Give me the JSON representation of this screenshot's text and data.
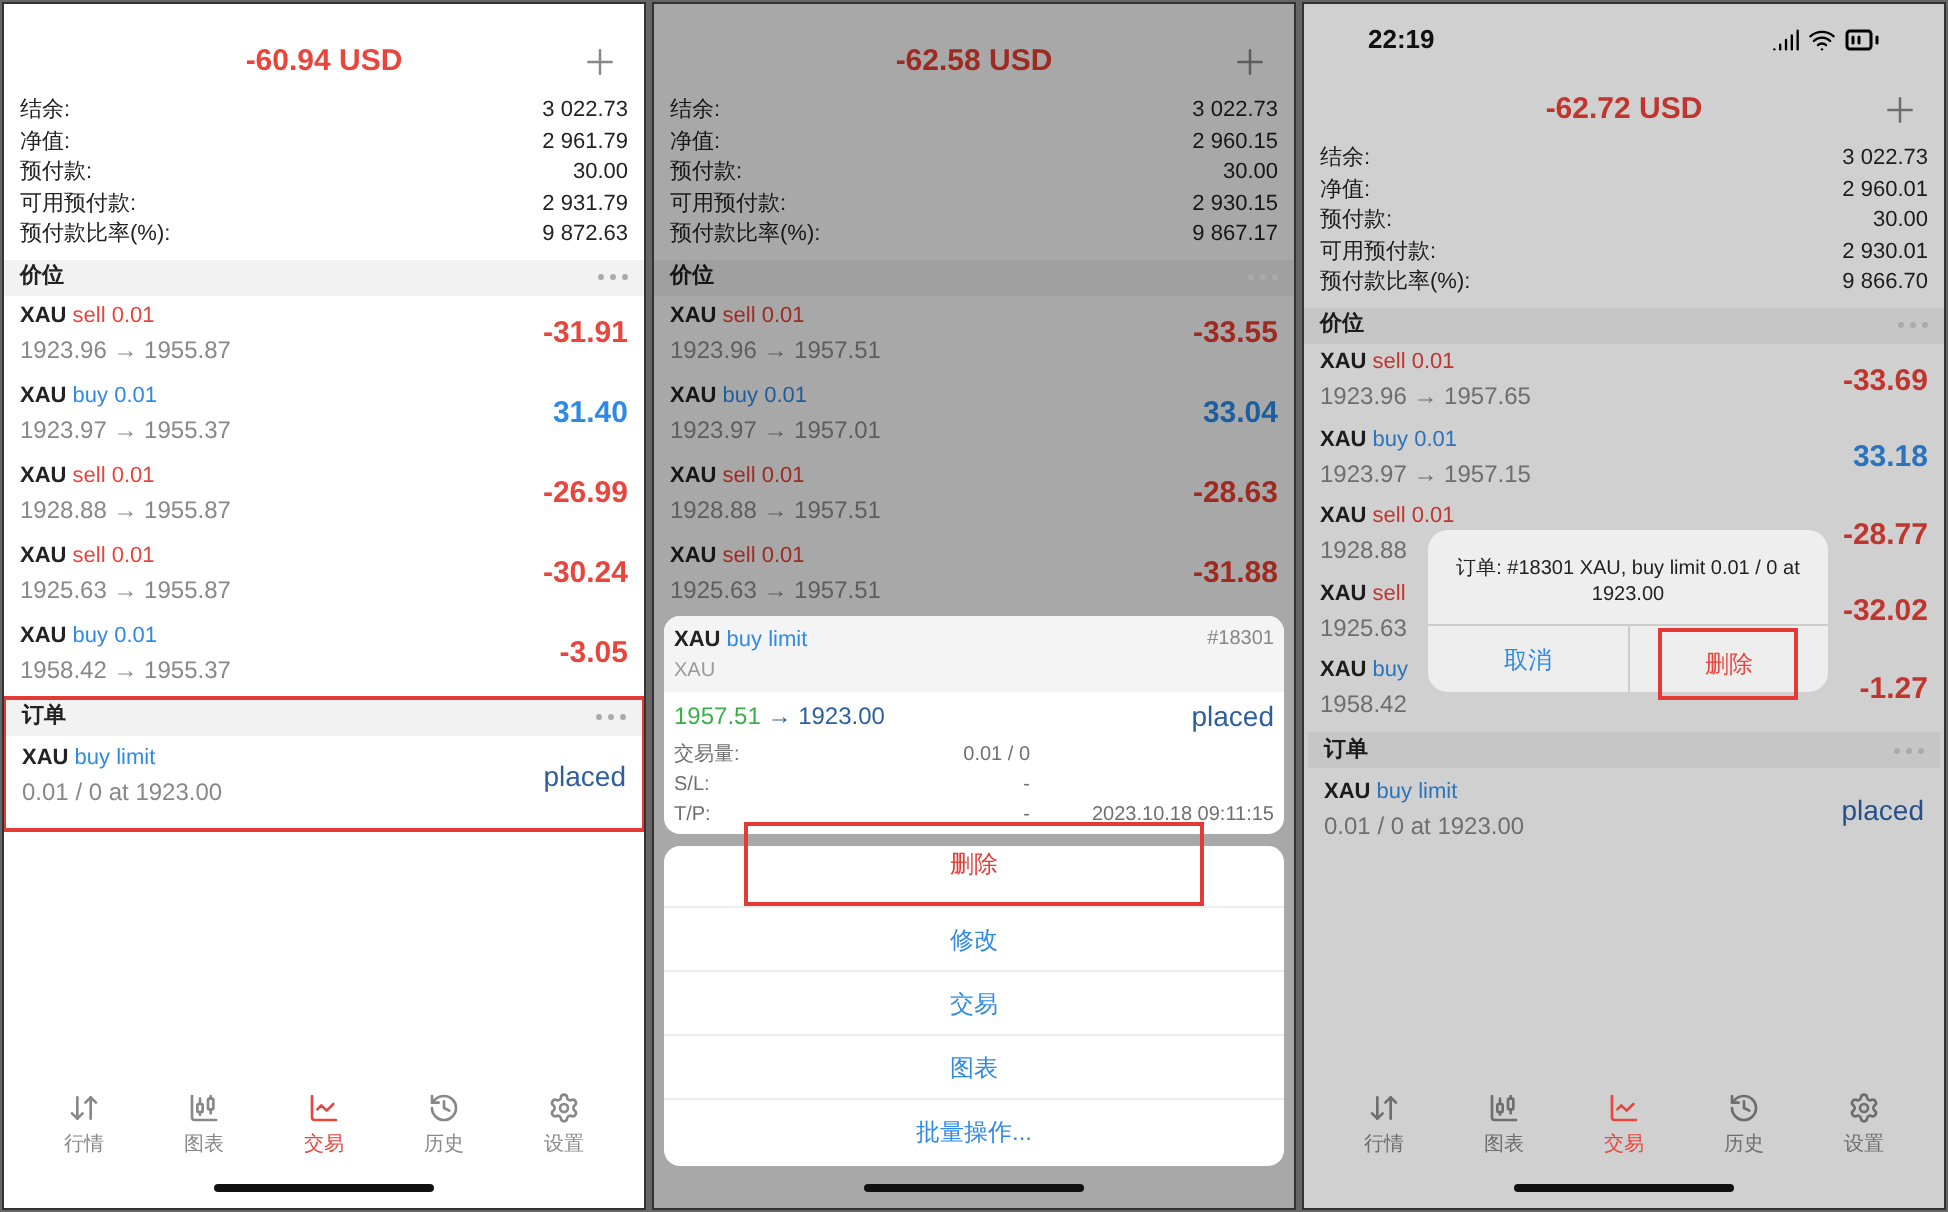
{
  "panels": [
    {
      "dimmed": false,
      "title": "-60.94 USD",
      "account": [
        {
          "label": "结余:",
          "value": "3 022.73"
        },
        {
          "label": "净值:",
          "value": "2 961.79"
        },
        {
          "label": "预付款:",
          "value": "30.00"
        },
        {
          "label": "可用预付款:",
          "value": "2 931.79"
        },
        {
          "label": "预付款比率(%):",
          "value": "9 872.63"
        }
      ],
      "positions_title": "价位",
      "positions": [
        {
          "symbol": "XAU",
          "side": "sell",
          "volume": "0.01",
          "prices": "1923.96 → 1955.87",
          "profit": "-31.91",
          "color": "#e8453c"
        },
        {
          "symbol": "XAU",
          "side": "buy",
          "volume": "0.01",
          "prices": "1923.97 → 1955.37",
          "profit": "31.40",
          "color": "#2f8ae5"
        },
        {
          "symbol": "XAU",
          "side": "sell",
          "volume": "0.01",
          "prices": "1928.88 → 1955.87",
          "profit": "-26.99",
          "color": "#e8453c"
        },
        {
          "symbol": "XAU",
          "side": "sell",
          "volume": "0.01",
          "prices": "1925.63 → 1955.87",
          "profit": "-30.24",
          "color": "#e8453c"
        },
        {
          "symbol": "XAU",
          "side": "buy",
          "volume": "0.01",
          "prices": "1958.42 → 1955.37",
          "profit": "-3.05",
          "color": "#e8453c"
        }
      ],
      "orders_title": "订单",
      "orders_highlighted": true,
      "orders": [
        {
          "symbol": "XAU",
          "type": "buy limit",
          "detail": "0.01 / 0 at 1923.00",
          "status": "placed"
        }
      ],
      "tabs": [
        {
          "label": "行情",
          "selected": false
        },
        {
          "label": "图表",
          "selected": false
        },
        {
          "label": "交易",
          "selected": true
        },
        {
          "label": "历史",
          "selected": false
        },
        {
          "label": "设置",
          "selected": false
        }
      ]
    },
    {
      "dimmed": true,
      "title": "-62.58 USD",
      "account": [
        {
          "label": "结余:",
          "value": "3 022.73"
        },
        {
          "label": "净值:",
          "value": "2 960.15"
        },
        {
          "label": "预付款:",
          "value": "30.00"
        },
        {
          "label": "可用预付款:",
          "value": "2 930.15"
        },
        {
          "label": "预付款比率(%):",
          "value": "9 867.17"
        }
      ],
      "positions_title": "价位",
      "positions": [
        {
          "symbol": "XAU",
          "side": "sell",
          "volume": "0.01",
          "prices": "1923.96 → 1957.51",
          "profit": "-33.55",
          "color": "#9e2a22"
        },
        {
          "symbol": "XAU",
          "side": "buy",
          "volume": "0.01",
          "prices": "1923.97 → 1957.01",
          "profit": "33.04",
          "color": "#1d5e9e"
        },
        {
          "symbol": "XAU",
          "side": "sell",
          "volume": "0.01",
          "prices": "1928.88 → 1957.51",
          "profit": "-28.63",
          "color": "#9e2a22"
        },
        {
          "symbol": "XAU",
          "side": "sell",
          "volume": "0.01",
          "prices": "1925.63 → 1957.51",
          "profit": "-31.88",
          "color": "#9e2a22"
        }
      ],
      "sheet": {
        "symbol": "XAU",
        "type": "buy limit",
        "ticket": "#18301",
        "subtitle": "XAU",
        "open_price": "1957.51",
        "target_price": "→ 1923.00",
        "status": "placed",
        "fields": [
          {
            "label": "交易量:",
            "value": "0.01 / 0"
          },
          {
            "label": "S/L:",
            "value": "-"
          },
          {
            "label": "T/P:",
            "value": "-",
            "time": "2023.10.18 09:11:15"
          }
        ],
        "actions": [
          {
            "label": "删除",
            "kind": "destructive",
            "highlighted": true
          },
          {
            "label": "修改",
            "kind": "default",
            "highlighted": false
          },
          {
            "label": "交易",
            "kind": "default",
            "highlighted": false
          },
          {
            "label": "图表",
            "kind": "default",
            "highlighted": false
          },
          {
            "label": "批量操作...",
            "kind": "default",
            "highlighted": false
          }
        ]
      }
    },
    {
      "dimmed": true,
      "status_time": "22:19",
      "title": "-62.72 USD",
      "account": [
        {
          "label": "结余:",
          "value": "3 022.73"
        },
        {
          "label": "净值:",
          "value": "2 960.01"
        },
        {
          "label": "预付款:",
          "value": "30.00"
        },
        {
          "label": "可用预付款:",
          "value": "2 930.01"
        },
        {
          "label": "预付款比率(%):",
          "value": "9 866.70"
        }
      ],
      "positions_title": "价位",
      "positions": [
        {
          "symbol": "XAU",
          "side": "sell",
          "volume": "0.01",
          "prices": "1923.96 → 1957.65",
          "profit": "-33.69",
          "color": "#c0362f"
        },
        {
          "symbol": "XAU",
          "side": "buy",
          "volume": "0.01",
          "prices": "1923.97 → 1957.15",
          "profit": "33.18",
          "color": "#2a74bd"
        },
        {
          "symbol": "XAU",
          "side": "sell",
          "volume": "0.01",
          "prices": "1928.88",
          "profit": "-28.77",
          "color": "#c0362f"
        },
        {
          "symbol": "XAU",
          "side": "sell",
          "prices": "1925.63",
          "profit": "-32.02",
          "color": "#c0362f"
        },
        {
          "symbol": "XAU",
          "side": "buy",
          "prices": "1958.42",
          "profit": "-1.27",
          "color": "#c0362f"
        }
      ],
      "orders_title": "订单",
      "orders_highlighted": false,
      "orders": [
        {
          "symbol": "XAU",
          "type": "buy limit",
          "detail": "0.01 / 0 at 1923.00",
          "status": "placed"
        }
      ],
      "tabs": [
        {
          "label": "行情",
          "selected": false
        },
        {
          "label": "图表",
          "selected": false
        },
        {
          "label": "交易",
          "selected": true
        },
        {
          "label": "历史",
          "selected": false
        },
        {
          "label": "设置",
          "selected": false
        }
      ],
      "alert": {
        "message": "订单: #18301 XAU, buy limit 0.01 / 0 at 1923.00",
        "buttons": [
          {
            "label": "取消",
            "kind": "cancel",
            "highlighted": false
          },
          {
            "label": "删除",
            "kind": "destructive",
            "highlighted": true
          }
        ]
      }
    }
  ]
}
